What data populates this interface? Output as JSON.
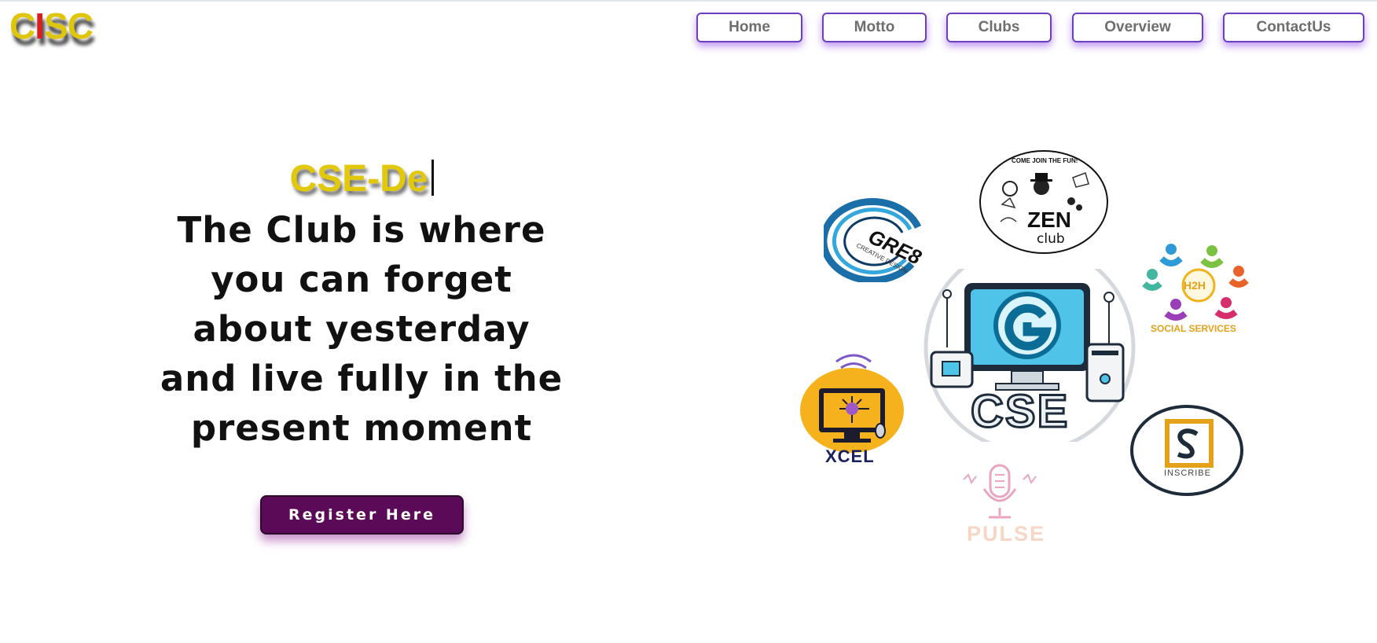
{
  "header": {
    "logo_letters": [
      {
        "char": "C",
        "color": "#e0c60a"
      },
      {
        "char": "I",
        "color": "#d81f1f"
      },
      {
        "char": "S",
        "color": "#e0c60a"
      },
      {
        "char": "C",
        "color": "#e0c60a"
      }
    ],
    "nav": [
      "Home",
      "Motto",
      "Clubs",
      "Overview",
      "ContactUs"
    ]
  },
  "hero": {
    "typing_text": "CSE-De",
    "tagline": "The Club is where you can forget about yesterday and live fully in the present moment",
    "register_label": "Register Here"
  },
  "clubs": {
    "zen": {
      "ring_text": "COME JOIN THE FUN!",
      "name": "ZEN",
      "sub": "club"
    },
    "gre8": {
      "name": "GRE8",
      "sub": "CREATIVE DESIGN"
    },
    "h2h": {
      "name": "H2H",
      "sub": "SOCIAL SERVICES"
    },
    "cse": {
      "name": "CSE"
    },
    "xcel": {
      "name": "XCEL"
    },
    "inscribe": {
      "name": "INSCRIBE"
    },
    "pulse": {
      "name": "PULSE"
    }
  },
  "colors": {
    "accent": "#6a3fc1",
    "button": "#5a0a56",
    "gold": "#e2c80a"
  }
}
